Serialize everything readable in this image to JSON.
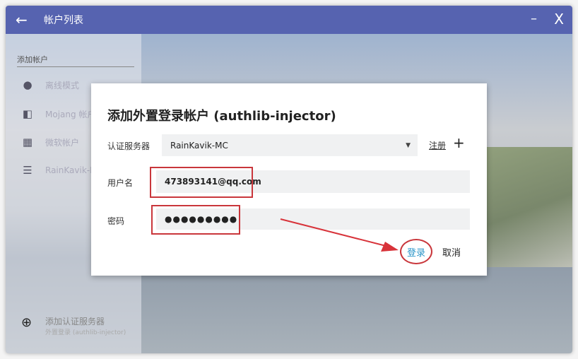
{
  "window": {
    "title": "帐户列表",
    "back": "←",
    "minimize": "–",
    "close": "X"
  },
  "sidebar": {
    "section": "添加帐户",
    "items": [
      {
        "icon": "person-icon",
        "glyph": "●",
        "label": "离线模式"
      },
      {
        "icon": "mojang-icon",
        "glyph": "◧",
        "label": "Mojang 帐户"
      },
      {
        "icon": "microsoft-icon",
        "glyph": "▦",
        "label": "微软帐户"
      },
      {
        "icon": "server-icon",
        "glyph": "☰",
        "label": "RainKavik-MC"
      }
    ],
    "add_server": {
      "glyph": "⊕",
      "label": "添加认证服务器",
      "sub": "外置登录 (authlib-injector)"
    }
  },
  "dialog": {
    "title": "添加外置登录帐户 (authlib-injector)",
    "server_label": "认证服务器",
    "server_value": "RainKavik-MC",
    "register": "注册",
    "add": "+",
    "username_label": "用户名",
    "username_value": "473893141@qq.com",
    "password_label": "密码",
    "password_value": "●●●●●●●●●",
    "login": "登录",
    "cancel": "取消"
  }
}
